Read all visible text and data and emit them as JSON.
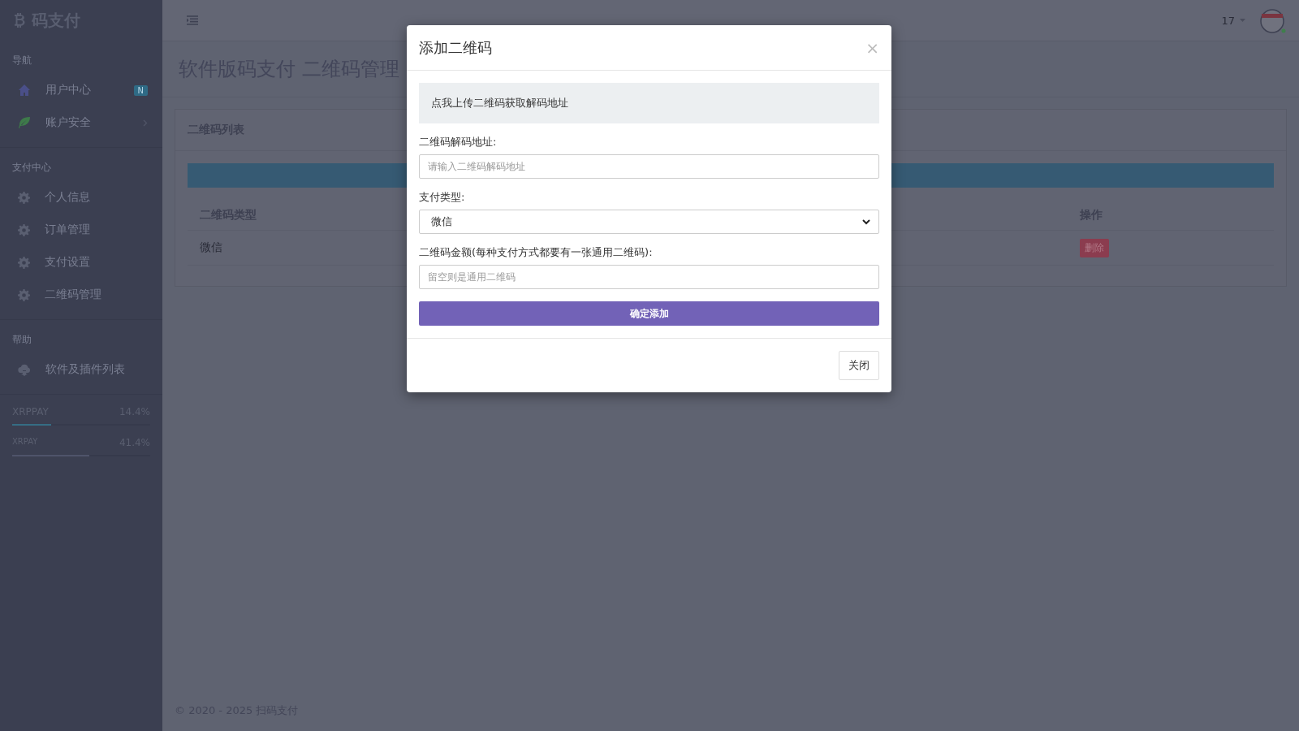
{
  "sidebar": {
    "logo": "码支付",
    "sections": [
      {
        "heading": "导航",
        "items": [
          {
            "label": "用户中心",
            "kind": "home",
            "badge": "N",
            "has_submenu": false
          },
          {
            "label": "账户安全",
            "kind": "leaf",
            "has_submenu": true
          }
        ]
      },
      {
        "heading": "支付中心",
        "items": [
          {
            "label": "个人信息",
            "kind": "gear",
            "has_submenu": false
          },
          {
            "label": "订单管理",
            "kind": "gear",
            "has_submenu": false
          },
          {
            "label": "支付设置",
            "kind": "gear",
            "has_submenu": false
          },
          {
            "label": "二维码管理",
            "kind": "gear",
            "has_submenu": false
          }
        ]
      },
      {
        "heading": "帮助",
        "items": [
          {
            "label": "软件及插件列表",
            "kind": "cloud",
            "has_submenu": false
          }
        ]
      }
    ],
    "stats": [
      {
        "name": "XRPPAY",
        "value": "14.4%",
        "level": 0.28
      },
      {
        "name": "XRPAY",
        "value": "41.4%",
        "level": 0.56
      }
    ]
  },
  "topbar": {
    "user": "17"
  },
  "page_title": "软件版码支付 二维码管理",
  "card": {
    "title": "二维码列表",
    "columns": [
      "二维码类型",
      "操作"
    ],
    "rows": [
      {
        "type": "微信",
        "action": "删除"
      }
    ]
  },
  "footer": "© 2020 - 2025 扫码支付",
  "modal": {
    "title": "添加二维码",
    "close": "×",
    "upload": "点我上传二维码获取解码地址",
    "fields": [
      {
        "kind": "input",
        "label": "二维码解码地址:",
        "placeholder": "请输入二维码解码地址"
      },
      {
        "kind": "select",
        "label": "支付类型:",
        "value": "微信"
      },
      {
        "kind": "input",
        "label": "二维码金额(每种支付方式都要有一张通用二维码):",
        "placeholder": "留空则是通用二维码"
      }
    ],
    "submit": "确定添加",
    "dismiss": "关闭"
  }
}
